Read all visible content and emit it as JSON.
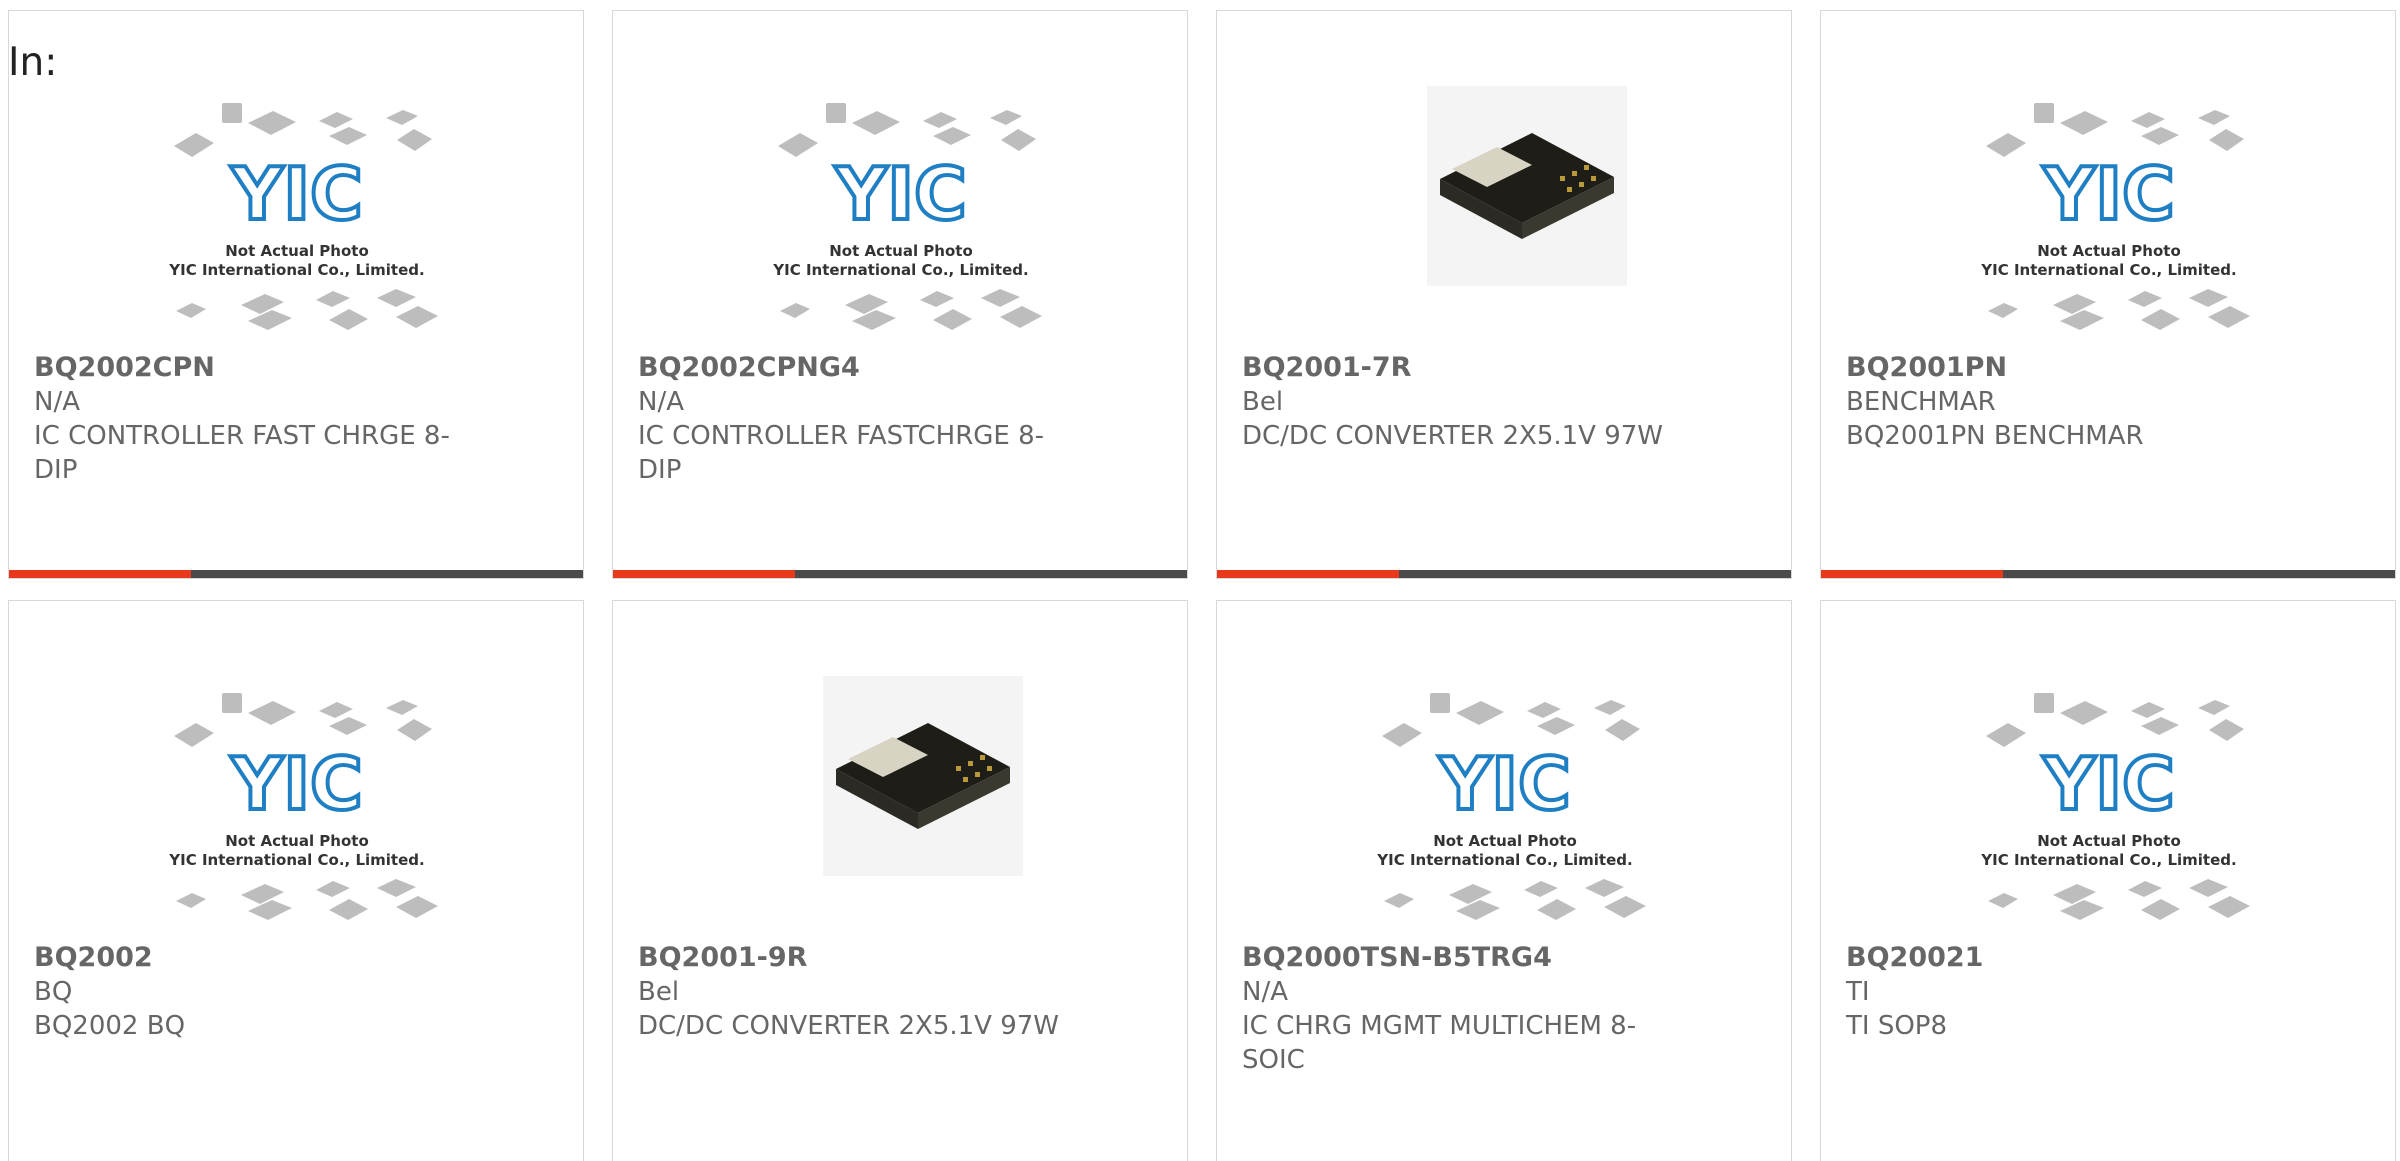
{
  "header": {
    "label": "In:"
  },
  "placeholder_photo": {
    "logo_text": "YIC",
    "line1": "Not Actual Photo",
    "line2": "YIC International Co., Limited."
  },
  "colors": {
    "accent": "#e8391b",
    "bar": "#4a4a4a",
    "logo": "#1f7fc4",
    "text": "#666666"
  },
  "products": [
    {
      "part": "BQ2002CPN",
      "mfr": "N/A",
      "desc": "IC CONTROLLER FAST CHRGE 8-DIP",
      "image": "placeholder"
    },
    {
      "part": "BQ2002CPNG4",
      "mfr": "N/A",
      "desc": "IC CONTROLLER FASTCHRGE 8-DIP",
      "image": "placeholder"
    },
    {
      "part": "BQ2001-7R",
      "mfr": "Bel",
      "desc": "DC/DC CONVERTER 2X5.1V 97W",
      "image": "converter"
    },
    {
      "part": "BQ2001PN",
      "mfr": "BENCHMAR",
      "desc": "BQ2001PN BENCHMAR",
      "image": "placeholder"
    },
    {
      "part": "BQ2002",
      "mfr": "BQ",
      "desc": "BQ2002 BQ",
      "image": "placeholder"
    },
    {
      "part": "BQ2001-9R",
      "mfr": "Bel",
      "desc": "DC/DC CONVERTER 2X5.1V 97W",
      "image": "converter"
    },
    {
      "part": "BQ2000TSN-B5TRG4",
      "mfr": "N/A",
      "desc": "IC CHRG MGMT MULTICHEM 8-SOIC",
      "image": "placeholder"
    },
    {
      "part": "BQ20021",
      "mfr": "TI",
      "desc": "TI SOP8",
      "image": "placeholder"
    }
  ]
}
